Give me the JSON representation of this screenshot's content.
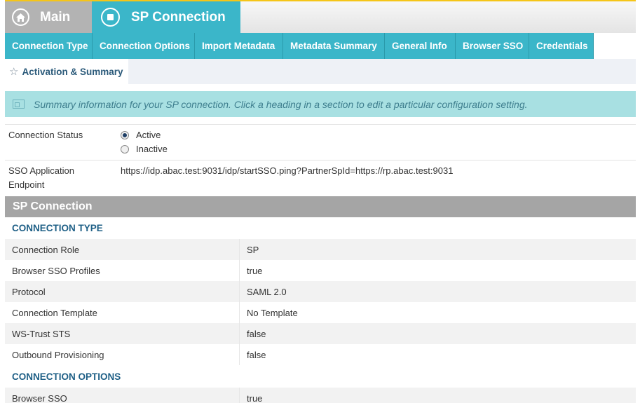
{
  "nav": {
    "main_label": "Main",
    "sp_label": "SP Connection"
  },
  "subtabs": [
    "Connection Type",
    "Connection Options",
    "Import Metadata",
    "Metadata Summary",
    "General Info",
    "Browser SSO",
    "Credentials"
  ],
  "active_subtab": "Activation & Summary",
  "info_message": "Summary information for your SP connection. Click a heading in a section to edit a particular configuration setting.",
  "status": {
    "label": "Connection Status",
    "options": [
      "Active",
      "Inactive"
    ],
    "selected": "Active"
  },
  "endpoint": {
    "label_line1": "SSO Application",
    "label_line2": "Endpoint",
    "value": "https://idp.abac.test:9031/idp/startSSO.ping?PartnerSpId=https://rp.abac.test:9031"
  },
  "section_title": "SP Connection",
  "groups": [
    {
      "title": "CONNECTION TYPE",
      "rows": [
        {
          "key": "Connection Role",
          "value": "SP"
        },
        {
          "key": "Browser SSO Profiles",
          "value": "true"
        },
        {
          "key": "Protocol",
          "value": "SAML 2.0"
        },
        {
          "key": "Connection Template",
          "value": "No Template"
        },
        {
          "key": "WS-Trust STS",
          "value": "false"
        },
        {
          "key": "Outbound Provisioning",
          "value": "false"
        }
      ]
    },
    {
      "title": "CONNECTION OPTIONS",
      "rows": [
        {
          "key": "Browser SSO",
          "value": "true"
        }
      ]
    }
  ],
  "colors": {
    "accent": "#3bb6c9",
    "info_bg": "#a8e0e2",
    "section_bg": "#a5a5a5",
    "group_title": "#1e5f86"
  },
  "icons": {
    "main": "home-icon",
    "sp": "stop-square-icon",
    "activation": "star-icon",
    "info": "info-panel-icon"
  }
}
